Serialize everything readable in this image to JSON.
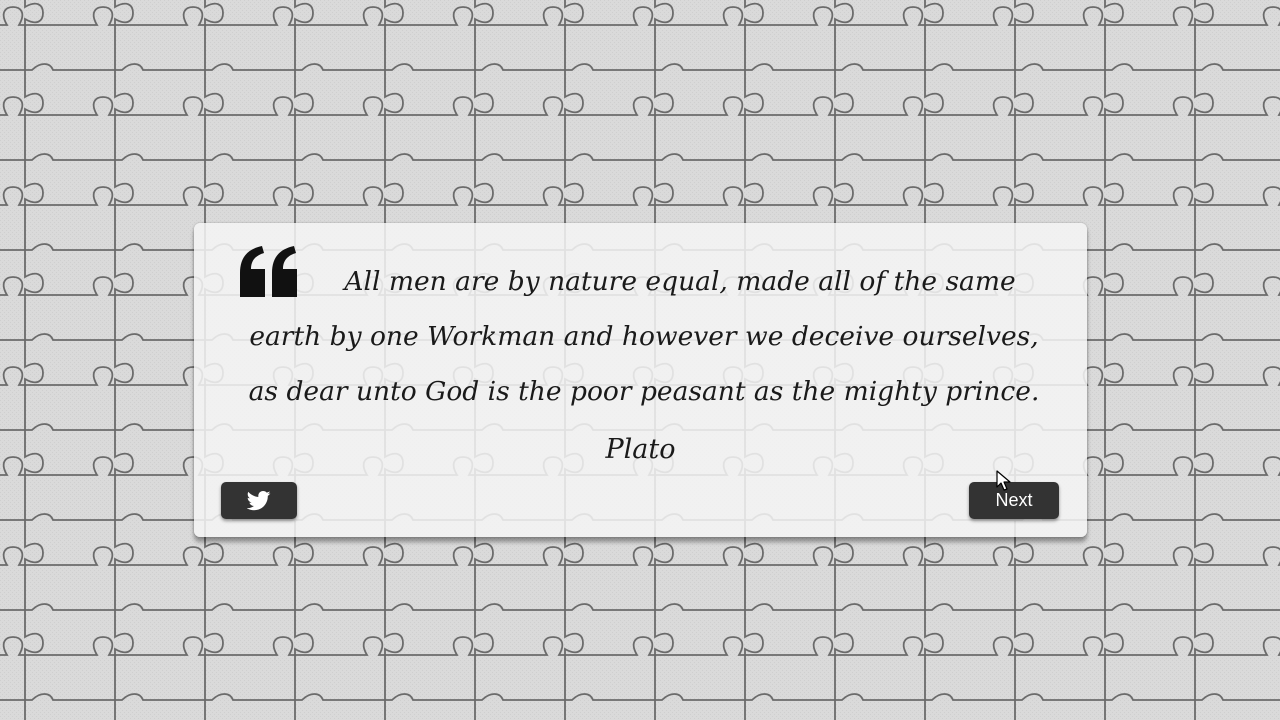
{
  "quote": {
    "text": "All men are by nature equal, made all of the same earth by one Workman and however we deceive ourselves, as dear unto God is the poor peasant as the mighty prince.",
    "author": "Plato"
  },
  "buttons": {
    "tweet_icon": "twitter-bird-icon",
    "next_label": "Next"
  },
  "icons": {
    "quote": "quote-mark-icon",
    "cursor": "mouse-pointer-icon"
  },
  "colors": {
    "background": "#d9d9d9",
    "puzzle_lines": "#6b6b6b",
    "card": "#f5f5f5",
    "text": "#1a1a1a",
    "button": "#333333",
    "button_text": "#ffffff"
  }
}
